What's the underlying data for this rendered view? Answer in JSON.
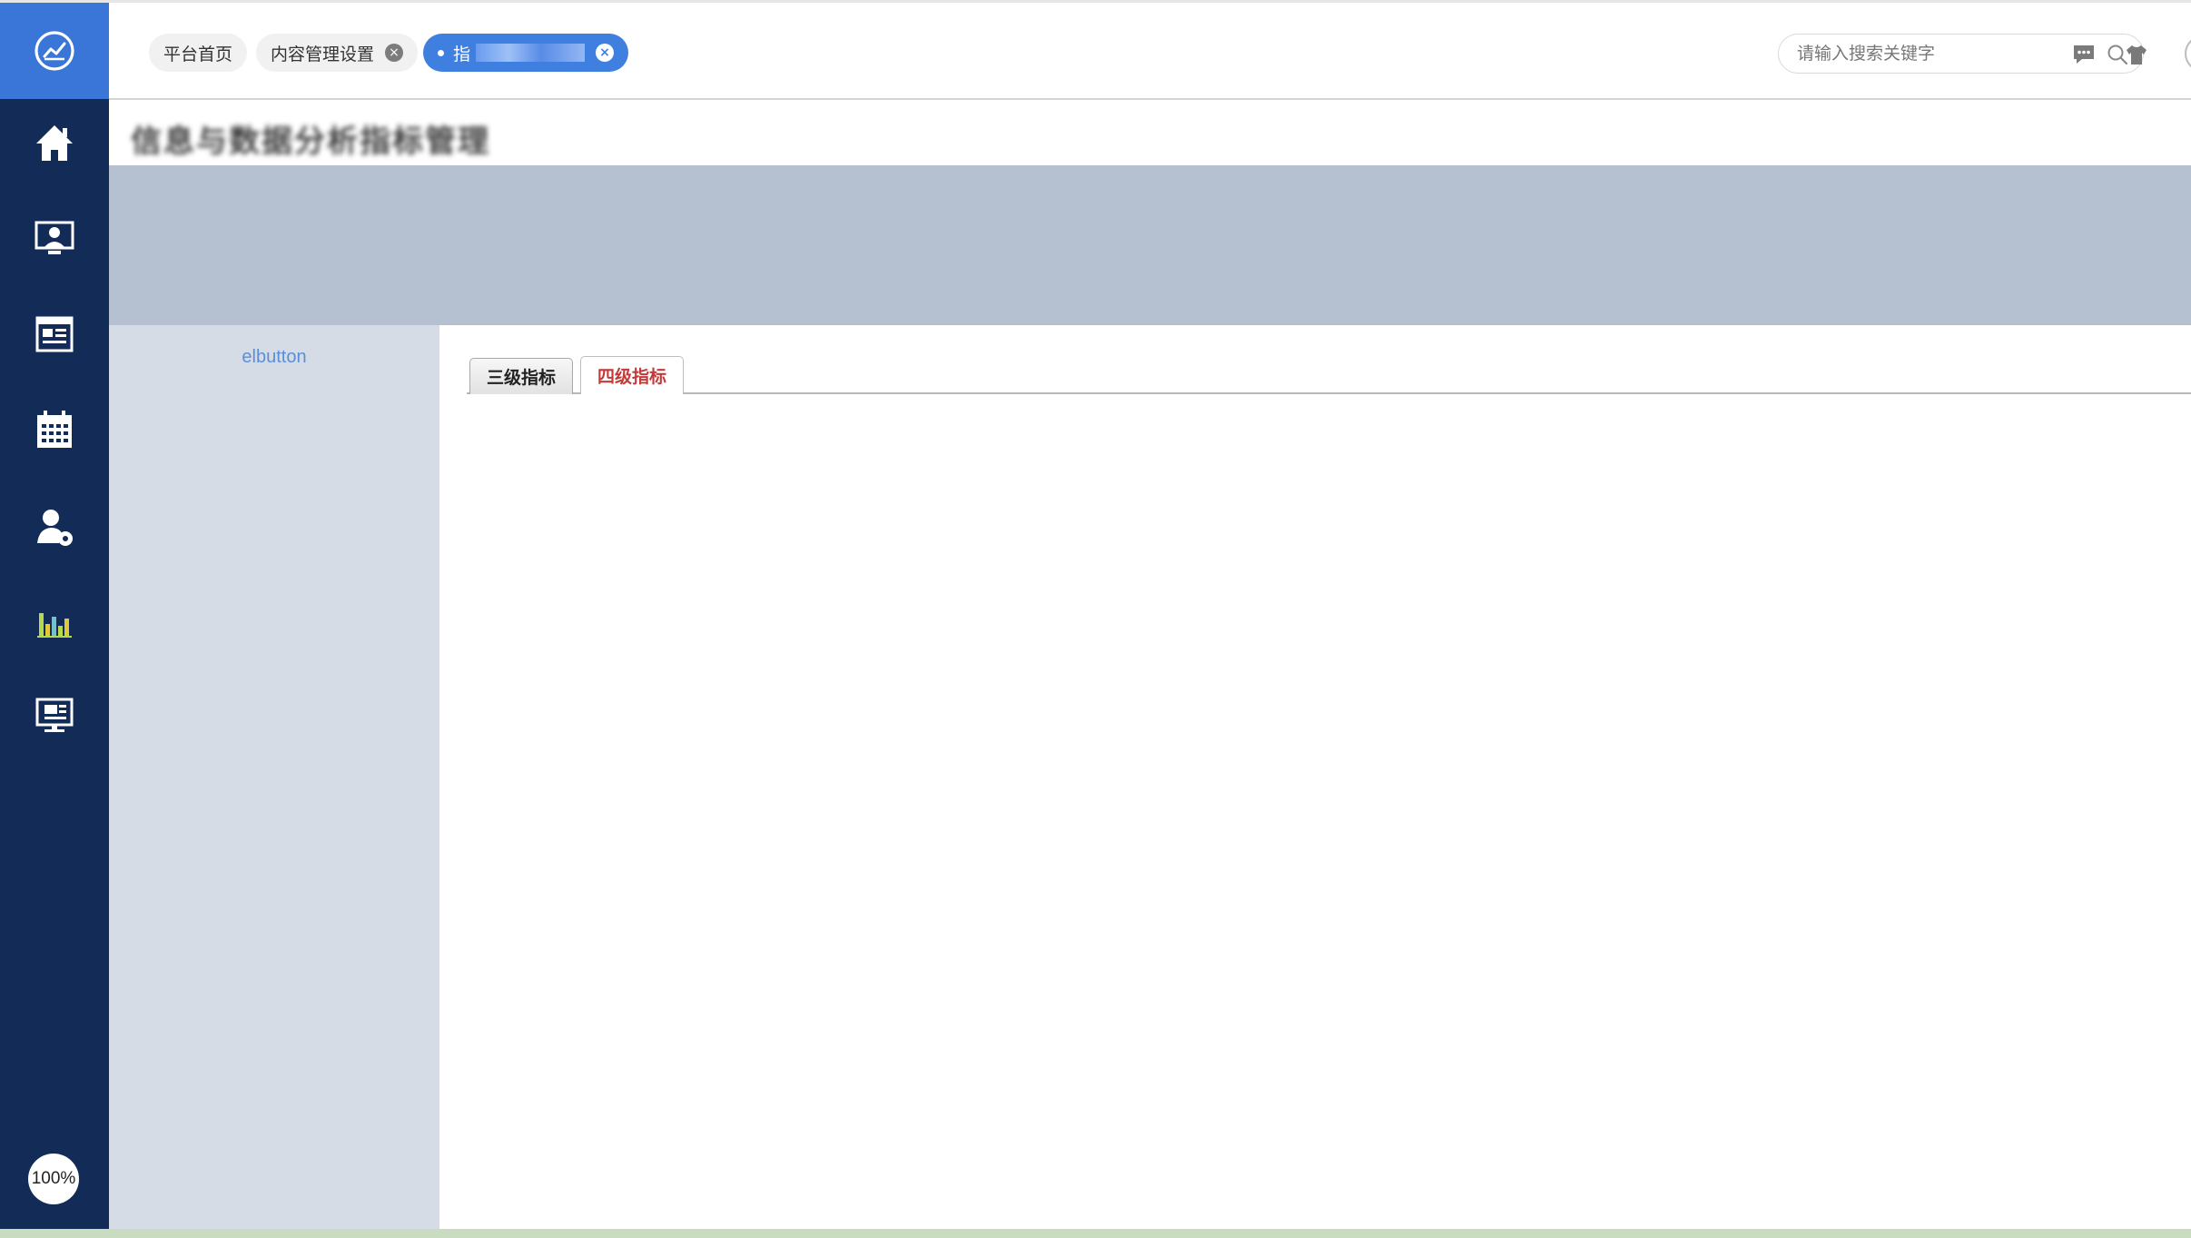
{
  "sidebar": {
    "logo_icon": "line-chart-logo-icon",
    "items": [
      {
        "icon": "home-icon"
      },
      {
        "icon": "user-screen-icon"
      },
      {
        "icon": "news-icon"
      },
      {
        "icon": "calendar-icon"
      },
      {
        "icon": "user-settings-icon"
      },
      {
        "icon": "bar-chart-icon"
      },
      {
        "icon": "monitor-icon"
      }
    ],
    "zoom_label": "100%"
  },
  "header": {
    "tabs": [
      {
        "label": "平台首页",
        "closable": false
      },
      {
        "label": "内容管理设置",
        "closable": true
      },
      {
        "label": "指",
        "closable": true,
        "active": true
      }
    ],
    "search": {
      "placeholder": "请输入搜索关键字"
    },
    "icons": [
      "message-icon",
      "shirt-icon"
    ]
  },
  "page": {
    "title": "信息与数据分析指标管理"
  },
  "left_panel": {
    "button_label": "elbutton"
  },
  "content": {
    "tabs": [
      {
        "label": "三级指标",
        "active": false
      },
      {
        "label": "四级指标",
        "active": true
      }
    ]
  },
  "colors": {
    "sidebar_bg": "#132b57",
    "logo_bg": "#3a76d8",
    "active_tab": "#3f7fe0",
    "banner": "#b5c0d0",
    "left_panel": "#d6dce6",
    "active_subtab_text": "#c43a3a"
  }
}
